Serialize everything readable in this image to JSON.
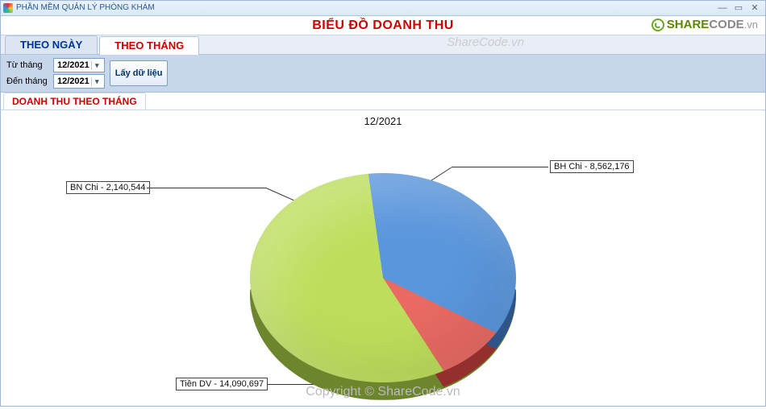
{
  "window": {
    "title": "PHẦN MỀM QUẢN LÝ PHÒNG KHÁM"
  },
  "brand": {
    "text_green": "SHARE",
    "text_grey_bold": "CODE",
    "tld": ".vn"
  },
  "header": {
    "title": "BIỂU ĐỒ DOANH THU"
  },
  "main_tabs": [
    {
      "label": "THEO NGÀY",
      "active": false
    },
    {
      "label": "THEO THÁNG",
      "active": true
    }
  ],
  "filter": {
    "from_label": "Từ tháng",
    "to_label": "Đến tháng",
    "from_value": "12/2021",
    "to_value": "12/2021",
    "fetch_label": "Lấy dữ liệu"
  },
  "sub_tabs": [
    {
      "label": "DOANH THU THEO THÁNG"
    }
  ],
  "chart_data": {
    "type": "pie",
    "title": "12/2021",
    "series": [
      {
        "name": "BH Chi",
        "value": 8562176,
        "label": "BH Chi - 8,562,176",
        "color": "#5a96dc"
      },
      {
        "name": "BN Chi",
        "value": 2140544,
        "label": "BN Chi - 2,140,544",
        "color": "#e86a63"
      },
      {
        "name": "Tiền DV",
        "value": 14090697,
        "label": "Tiền DV  - 14,090,697",
        "color": "#bdde5c"
      }
    ]
  },
  "watermarks": {
    "top": "ShareCode.vn",
    "bottom": "Copyright © ShareCode.vn"
  }
}
